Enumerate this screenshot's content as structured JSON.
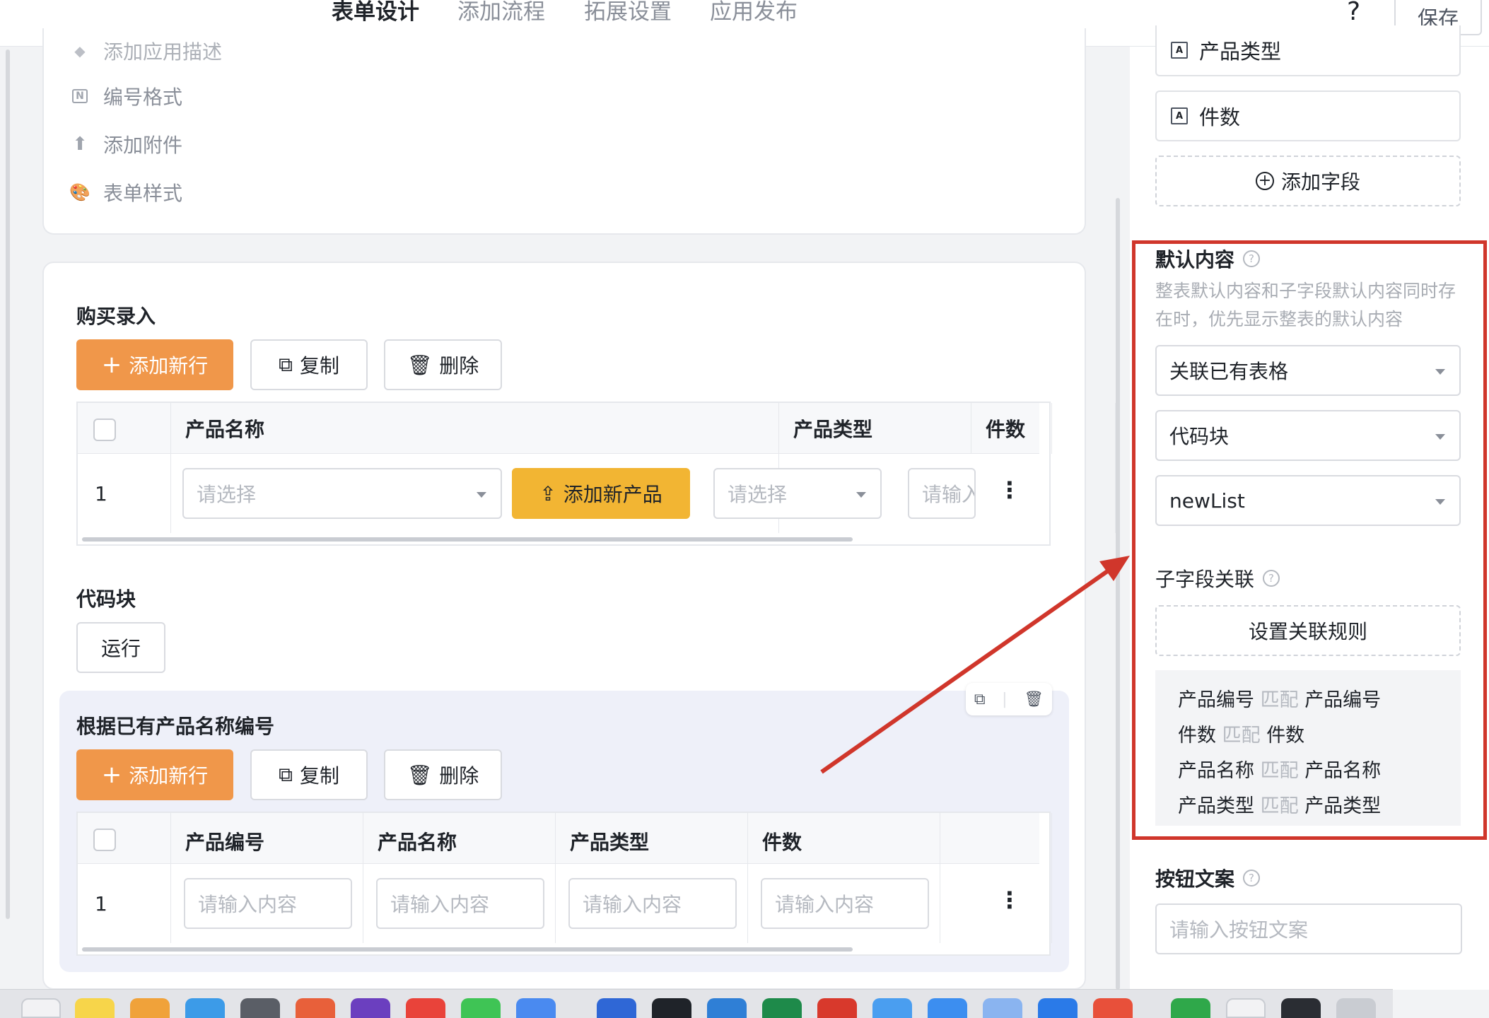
{
  "topbar": {
    "tabs": [
      "表单设计",
      "添加流程",
      "拓展设置",
      "应用发布"
    ],
    "active_tab": "表单设计",
    "help": "?",
    "save_label": "保存",
    "accent_color": "#f0913e"
  },
  "settings_menu": {
    "items": [
      {
        "label": "添加应用描述",
        "icon": "chat-icon"
      },
      {
        "label": "编号格式",
        "icon": "numbering-icon"
      },
      {
        "label": "添加附件",
        "icon": "upload-icon"
      },
      {
        "label": "表单样式",
        "icon": "palette-icon"
      }
    ]
  },
  "purchase": {
    "title": "购买录入",
    "add_row": "添加新行",
    "copy": "复制",
    "delete": "删除",
    "columns": [
      "产品名称",
      "产品类型",
      "件数"
    ],
    "row": {
      "num": "1",
      "name_placeholder": "请选择",
      "add_product": "添加新产品",
      "type_placeholder": "请选择",
      "count_placeholder": "请输入"
    }
  },
  "codeblock": {
    "title": "代码块",
    "run": "运行"
  },
  "sub_table": {
    "title": "根据已有产品名称编号",
    "add_row": "添加新行",
    "copy": "复制",
    "delete": "删除",
    "columns": [
      "产品编号",
      "产品名称",
      "产品类型",
      "件数"
    ],
    "row": {
      "num": "1",
      "placeholders": [
        "请输入内容",
        "请输入内容",
        "请输入内容",
        "请输入内容"
      ]
    }
  },
  "right_panel": {
    "fields": [
      "产品类型",
      "件数"
    ],
    "add_field": "添加字段",
    "default_content": {
      "title": "默认内容",
      "description": "整表默认内容和子字段默认内容同时存在时，优先显示整表的默认内容",
      "select1": "关联已有表格",
      "select2": "代码块",
      "select3": "newList"
    },
    "sub_field": {
      "title": "子字段关联",
      "set_rules": "设置关联规则",
      "match_word": "匹配",
      "rules": [
        {
          "from": "产品编号",
          "to": "产品编号"
        },
        {
          "from": "件数",
          "to": "件数"
        },
        {
          "from": "产品名称",
          "to": "产品名称"
        },
        {
          "from": "产品类型",
          "to": "产品类型"
        }
      ]
    },
    "button_text": {
      "title": "按钮文案",
      "placeholder": "请输入按钮文案"
    },
    "highlight_color": "#d0362b"
  }
}
